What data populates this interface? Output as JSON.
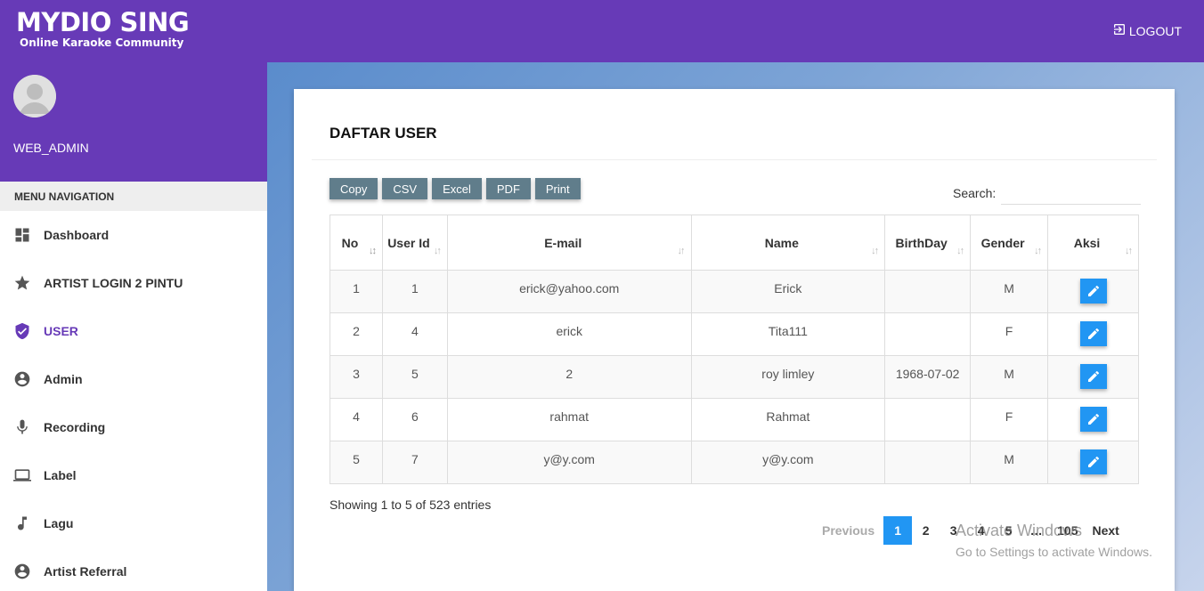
{
  "header": {
    "logo_main": "MYDIO SING",
    "logo_sub": "Online Karaoke Community",
    "logout_label": "LOGOUT"
  },
  "sidebar": {
    "username": "WEB_ADMIN",
    "menu_header": "MENU NAVIGATION",
    "items": [
      {
        "label": "Dashboard",
        "icon": "dashboard-icon"
      },
      {
        "label": "ARTIST LOGIN 2 PINTU",
        "icon": "star-icon"
      },
      {
        "label": "USER",
        "icon": "shield-check-icon",
        "active": true
      },
      {
        "label": "Admin",
        "icon": "account-circle-icon"
      },
      {
        "label": "Recording",
        "icon": "microphone-icon"
      },
      {
        "label": "Label",
        "icon": "laptop-icon"
      },
      {
        "label": "Lagu",
        "icon": "music-note-icon"
      },
      {
        "label": "Artist Referral",
        "icon": "account-circle-icon"
      }
    ],
    "accent_color": "#673ab7"
  },
  "main": {
    "title": "DAFTAR USER",
    "export_buttons": [
      "Copy",
      "CSV",
      "Excel",
      "PDF",
      "Print"
    ],
    "search_label": "Search:",
    "search_value": "",
    "table": {
      "columns": [
        "No",
        "User Id",
        "E-mail",
        "Name",
        "BirthDay",
        "Gender",
        "Aksi"
      ],
      "rows": [
        {
          "no": "1",
          "user_id": "1",
          "email": "erick@yahoo.com",
          "name": "Erick",
          "birthday": "",
          "gender": "M"
        },
        {
          "no": "2",
          "user_id": "4",
          "email": "erick",
          "name": "Tita111",
          "birthday": "",
          "gender": "F"
        },
        {
          "no": "3",
          "user_id": "5",
          "email": "2",
          "name": "roy limley",
          "birthday": "1968-07-02",
          "gender": "M"
        },
        {
          "no": "4",
          "user_id": "6",
          "email": "rahmat",
          "name": "Rahmat",
          "birthday": "",
          "gender": "F"
        },
        {
          "no": "5",
          "user_id": "7",
          "email": "y@y.com",
          "name": "y@y.com",
          "birthday": "",
          "gender": "M"
        }
      ]
    },
    "info": "Showing 1 to 5 of 523 entries",
    "pagination": {
      "previous": "Previous",
      "pages": [
        "1",
        "2",
        "3",
        "4",
        "5"
      ],
      "ellipsis": "…",
      "last": "105",
      "next": "Next",
      "current": "1"
    }
  },
  "watermark": {
    "line1": "Activate Windows",
    "line2": "Go to Settings to activate Windows."
  }
}
